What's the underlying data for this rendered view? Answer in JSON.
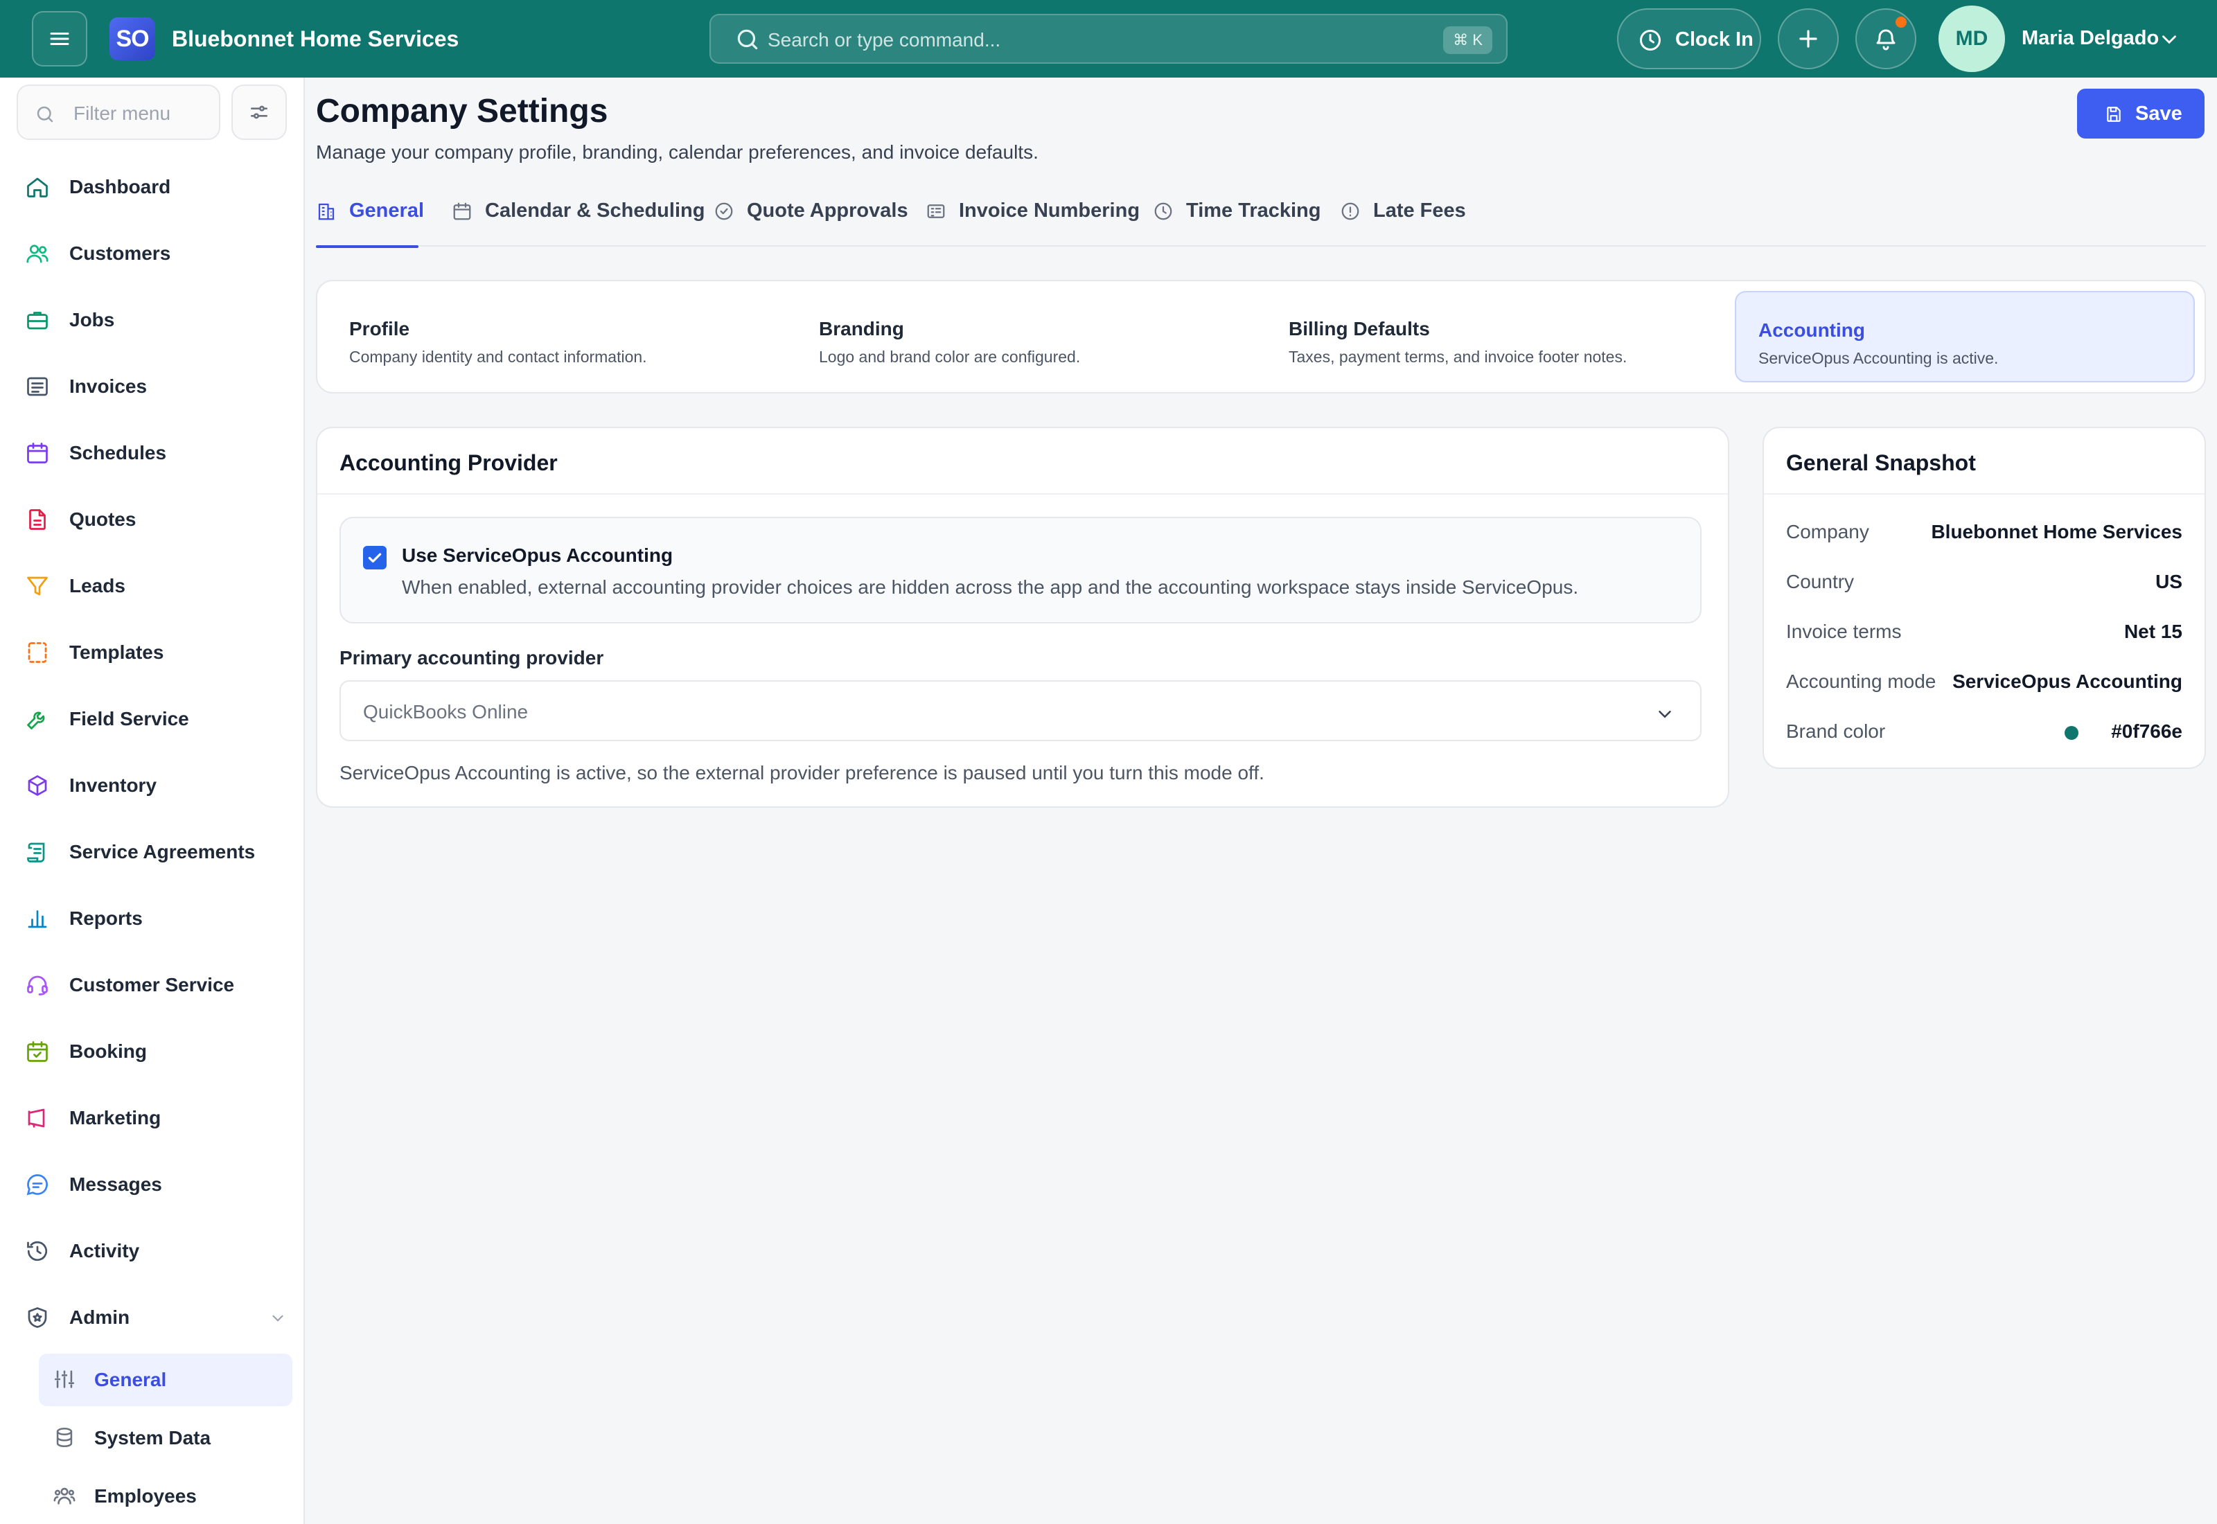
{
  "app": {
    "logo_text": "SO",
    "company_name": "Bluebonnet Home Services"
  },
  "header": {
    "search_placeholder": "Search or type command...",
    "search_shortcut": "⌘ K",
    "clock_in_label": "Clock In",
    "user_initials": "MD",
    "user_name": "Maria Delgado"
  },
  "sidebar": {
    "filter_placeholder": "Filter menu",
    "items": [
      {
        "label": "Dashboard",
        "icon": "home-icon",
        "color": "#0f766e"
      },
      {
        "label": "Customers",
        "icon": "users-icon",
        "color": "#10b981"
      },
      {
        "label": "Jobs",
        "icon": "briefcase-icon",
        "color": "#059669"
      },
      {
        "label": "Invoices",
        "icon": "receipt-icon",
        "color": "#475569"
      },
      {
        "label": "Schedules",
        "icon": "calendar-icon",
        "color": "#7c3aed"
      },
      {
        "label": "Quotes",
        "icon": "file-text-icon",
        "color": "#e11d48"
      },
      {
        "label": "Leads",
        "icon": "funnel-icon",
        "color": "#f59e0b"
      },
      {
        "label": "Templates",
        "icon": "template-icon",
        "color": "#f97316"
      },
      {
        "label": "Field Service",
        "icon": "wrench-icon",
        "color": "#16a34a"
      },
      {
        "label": "Inventory",
        "icon": "box-icon",
        "color": "#7c3aed"
      },
      {
        "label": "Service Agreements",
        "icon": "scroll-icon",
        "color": "#0d9488"
      },
      {
        "label": "Reports",
        "icon": "bar-chart-icon",
        "color": "#0284c7"
      },
      {
        "label": "Customer Service",
        "icon": "headset-icon",
        "color": "#a855f7"
      },
      {
        "label": "Booking",
        "icon": "calendar-check-icon",
        "color": "#65a30d"
      },
      {
        "label": "Marketing",
        "icon": "megaphone-icon",
        "color": "#db2777"
      },
      {
        "label": "Messages",
        "icon": "chat-icon",
        "color": "#3b82f6"
      },
      {
        "label": "Activity",
        "icon": "history-icon",
        "color": "#475569"
      },
      {
        "label": "Admin",
        "icon": "shield-icon",
        "color": "#475569"
      }
    ],
    "admin_sub": [
      {
        "label": "General",
        "icon": "sliders-icon",
        "active": true
      },
      {
        "label": "System Data",
        "icon": "database-icon",
        "active": false
      },
      {
        "label": "Employees",
        "icon": "team-icon",
        "active": false
      }
    ]
  },
  "page": {
    "title": "Company Settings",
    "subtitle": "Manage your company profile, branding, calendar preferences, and invoice defaults.",
    "save_label": "Save"
  },
  "tabs": [
    {
      "label": "General",
      "icon": "building-icon",
      "active": true
    },
    {
      "label": "Calendar & Scheduling",
      "icon": "calendar-icon",
      "active": false
    },
    {
      "label": "Quote Approvals",
      "icon": "badge-check-icon",
      "active": false
    },
    {
      "label": "Invoice Numbering",
      "icon": "list-numbered-icon",
      "active": false
    },
    {
      "label": "Time Tracking",
      "icon": "clock-icon",
      "active": false
    },
    {
      "label": "Late Fees",
      "icon": "alert-circle-icon",
      "active": false
    }
  ],
  "sections": [
    {
      "title": "Profile",
      "desc": "Company identity and contact information.",
      "active": false
    },
    {
      "title": "Branding",
      "desc": "Logo and brand color are configured.",
      "active": false
    },
    {
      "title": "Billing Defaults",
      "desc": "Taxes, payment terms, and invoice footer notes.",
      "active": false
    },
    {
      "title": "Accounting",
      "desc": "ServiceOpus Accounting is active.",
      "active": true
    }
  ],
  "accounting": {
    "panel_title": "Accounting Provider",
    "toggle_label": "Use ServiceOpus Accounting",
    "toggle_checked": true,
    "toggle_desc": "When enabled, external accounting provider choices are hidden across the app and the accounting workspace stays inside ServiceOpus.",
    "provider_label": "Primary accounting provider",
    "provider_value": "QuickBooks Online",
    "help_text": "ServiceOpus Accounting is active, so the external provider preference is paused until you turn this mode off."
  },
  "snapshot": {
    "title": "General Snapshot",
    "rows": [
      {
        "key": "Company",
        "value": "Bluebonnet Home Services"
      },
      {
        "key": "Country",
        "value": "US"
      },
      {
        "key": "Invoice terms",
        "value": "Net 15"
      },
      {
        "key": "Accounting mode",
        "value": "ServiceOpus Accounting"
      },
      {
        "key": "Brand color",
        "value": "#0f766e"
      }
    ]
  },
  "colors": {
    "brand": "#0f766e",
    "accent": "#3b4ee0",
    "save_button": "#3d5ef0"
  }
}
